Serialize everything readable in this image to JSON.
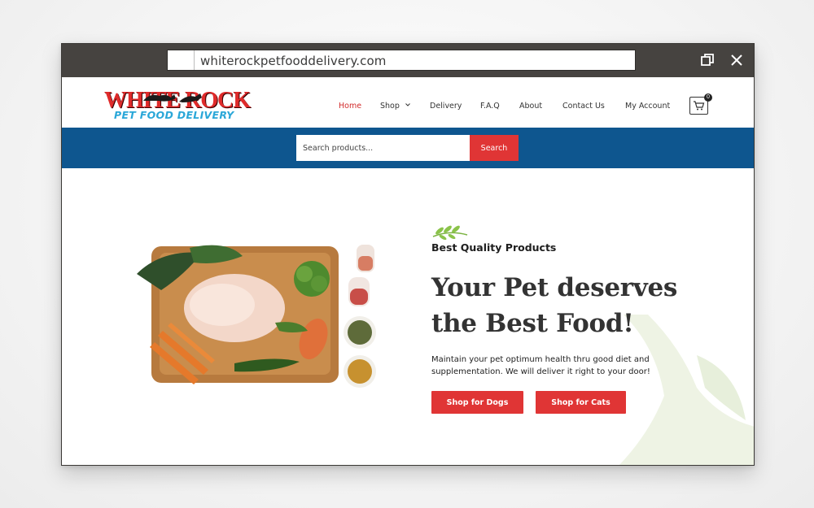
{
  "browser": {
    "url": "whiterockpetfooddelivery.com"
  },
  "logo": {
    "line1": "WHITE ROCK",
    "line2": "PET FOOD DELIVERY"
  },
  "nav": {
    "items": [
      {
        "label": "Home",
        "active": true
      },
      {
        "label": "Shop",
        "has_dropdown": true
      },
      {
        "label": "Delivery"
      },
      {
        "label": "F.A.Q"
      },
      {
        "label": "About"
      },
      {
        "label": "Contact Us"
      },
      {
        "label": "My Account"
      }
    ],
    "cart_count": "0"
  },
  "search": {
    "placeholder": "Search products...",
    "button_label": "Search"
  },
  "hero": {
    "eyebrow": "Best Quality Products",
    "headline": "Your Pet deserves the Best Food!",
    "description": "Maintain your pet optimum health thru good diet and supplementation. We will deliver it right to your door!",
    "buttons": [
      "Shop for Dogs",
      "Shop for Cats"
    ]
  },
  "colors": {
    "accent": "#e03535",
    "band": "#0e568f",
    "titlebar": "#464340",
    "logo_red": "#e02b2b",
    "logo_blue": "#2aa7d8"
  },
  "icons": [
    "restore-icon",
    "close-icon",
    "chevron-down-icon",
    "cart-icon",
    "leaf-sprig-icon"
  ]
}
